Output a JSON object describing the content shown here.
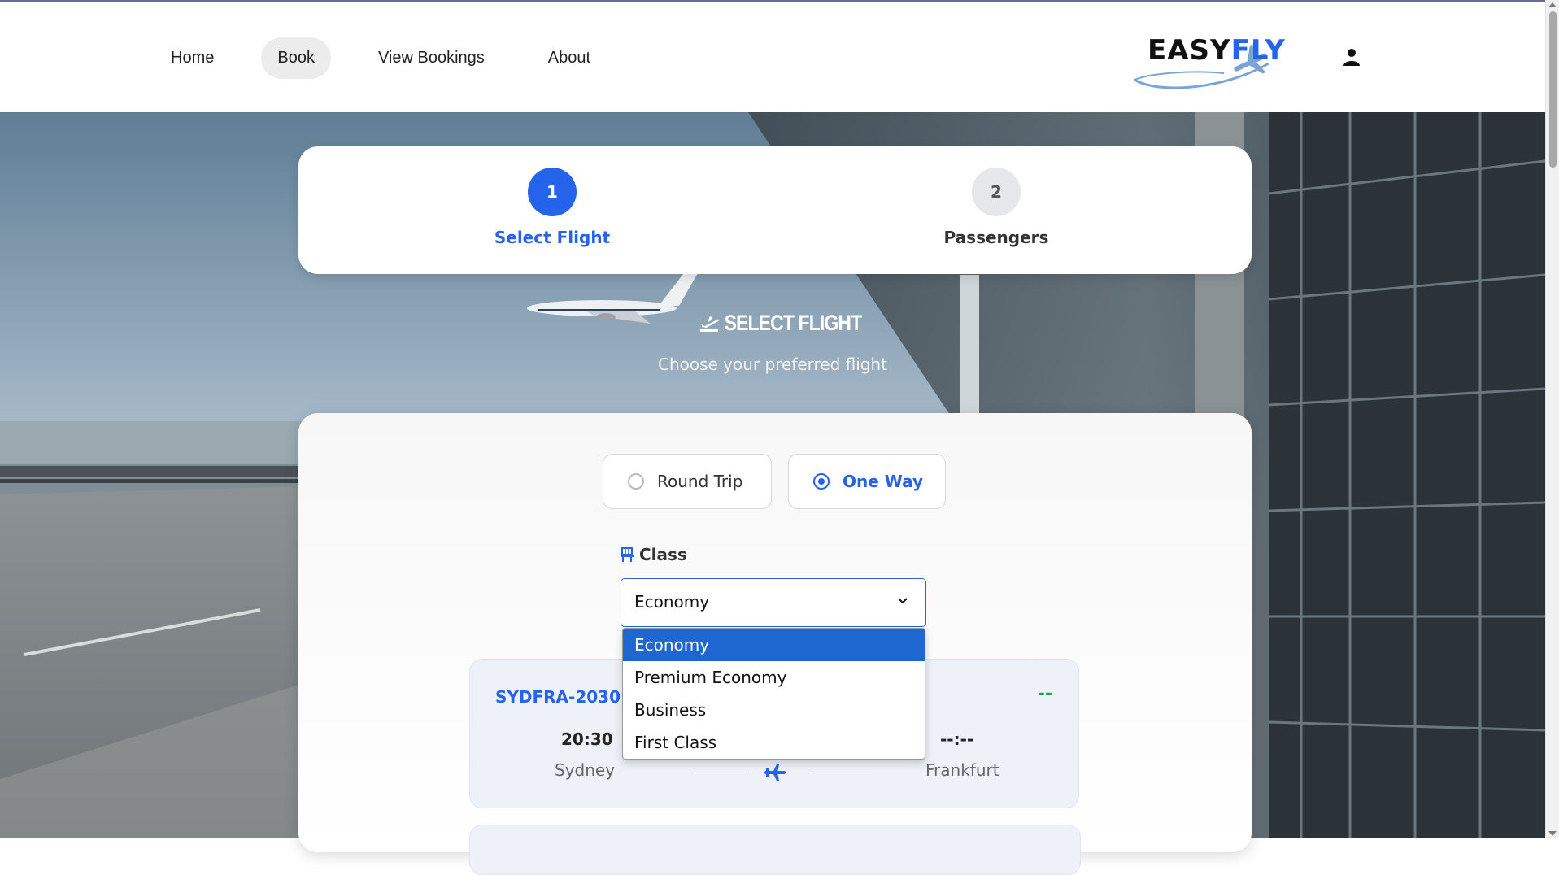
{
  "nav": {
    "items": [
      {
        "label": "Home"
      },
      {
        "label": "Book",
        "active": true
      },
      {
        "label": "View Bookings"
      },
      {
        "label": "About"
      }
    ]
  },
  "logo": {
    "part1": "EASY",
    "part2": "FLY"
  },
  "steps": [
    {
      "number": "1",
      "label": "Select Flight",
      "state": "active"
    },
    {
      "number": "2",
      "label": "Passengers",
      "state": "inactive"
    }
  ],
  "section": {
    "title": "SELECT FLIGHT",
    "subtitle": "Choose your preferred flight"
  },
  "trip_type": {
    "round_trip": "Round Trip",
    "one_way": "One Way",
    "selected": "One Way"
  },
  "class_select": {
    "label": "Class",
    "value": "Economy",
    "options": [
      "Economy",
      "Premium Economy",
      "Business",
      "First Class"
    ],
    "highlighted": "Economy"
  },
  "flight": {
    "code": "SYDFRA-2030",
    "status": "--",
    "departure_time": "20:30",
    "arrival_time": "--:--",
    "from": "Sydney",
    "to": "Frankfurt"
  },
  "colors": {
    "accent": "#2563eb",
    "status": "#16a34a",
    "highlight": "#1e66d0"
  }
}
